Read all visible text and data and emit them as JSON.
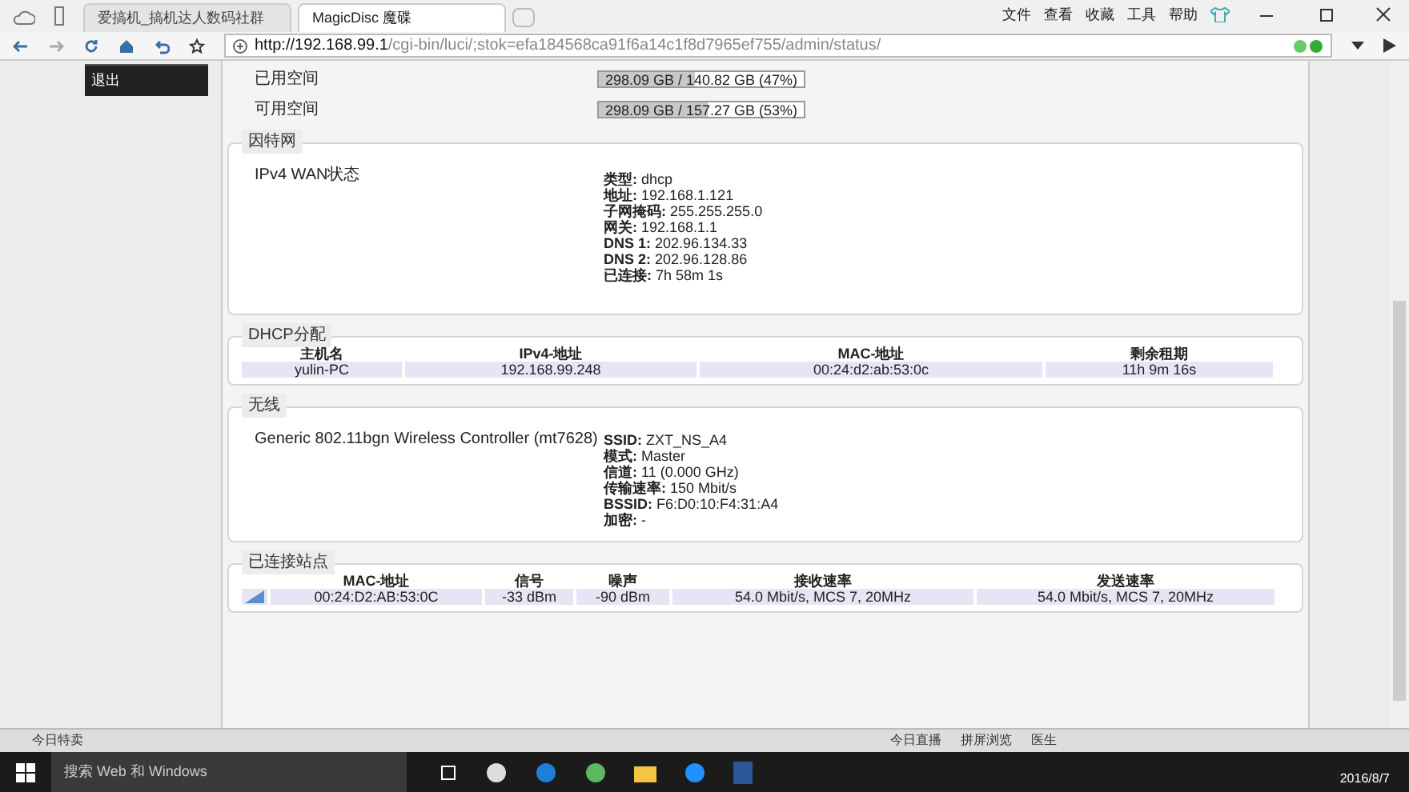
{
  "browser": {
    "tabs": [
      {
        "title": "爱搞机_搞机达人数码社群",
        "selected": false
      },
      {
        "title": "MagicDisc 魔碟",
        "selected": true
      }
    ],
    "menu": [
      "文件",
      "查看",
      "收藏",
      "工具",
      "帮助"
    ],
    "address": {
      "host": "http://192.168.99.1",
      "path": "/cgi-bin/luci/;stok=efa184568ca91f6a14c1f8d7965ef755/admin/status/"
    }
  },
  "side_menu": {
    "item": "退出"
  },
  "storage": [
    {
      "label": "已用空间",
      "reading": "298.09 GB / 140.82 GB (47%)",
      "level": 0.47
    },
    {
      "label": "可用空间",
      "reading": "298.09 GB / 157.27 GB (53%)",
      "level": 0.53
    }
  ],
  "internet": {
    "legend": "因特网",
    "name": "IPv4 WAN状态",
    "details": [
      {
        "key": "类型:",
        "value": "dhcp"
      },
      {
        "key": "地址:",
        "value": "192.168.1.121"
      },
      {
        "key": "子网掩码:",
        "value": "255.255.255.0"
      },
      {
        "key": "网关:",
        "value": "192.168.1.1"
      },
      {
        "key": "DNS 1:",
        "value": "202.96.134.33"
      },
      {
        "key": "DNS 2:",
        "value": "202.96.128.86"
      },
      {
        "key": "已连接:",
        "value": "7h 58m 1s"
      }
    ]
  },
  "dhcp": {
    "legend": "DHCP分配",
    "columns": [
      "主机名",
      "IPv4-地址",
      "MAC-地址",
      "剩余租期"
    ],
    "rows": [
      [
        "yulin-PC",
        "192.168.99.248",
        "00:24:d2:ab:53:0c",
        "11h 9m 16s"
      ]
    ]
  },
  "wireless": {
    "legend": "无线",
    "name": "Generic 802.11bgn Wireless Controller (mt7628)",
    "details": [
      {
        "key": "SSID:",
        "value": "ZXT_NS_A4"
      },
      {
        "key": "模式:",
        "value": "Master"
      },
      {
        "key": "信道:",
        "value": "11 (0.000 GHz)"
      },
      {
        "key": "传输速率:",
        "value": "150 Mbit/s"
      },
      {
        "key": "BSSID:",
        "value": "F6:D0:10:F4:31:A4"
      },
      {
        "key": "加密:",
        "value": "-"
      }
    ]
  },
  "stations": {
    "legend": "已连接站点",
    "columns": [
      "MAC-地址",
      "信号",
      "噪声",
      "接收速率",
      "发送速率"
    ],
    "rows": [
      [
        "00:24:D2:AB:53:0C",
        "-33 dBm",
        "-90 dBm",
        "54.0 Mbit/s, MCS 7, 20MHz",
        "54.0 Mbit/s, MCS 7, 20MHz"
      ]
    ]
  },
  "status_bar": {
    "left": "今日特卖",
    "right": [
      "今日直播",
      "拼屏浏览",
      "医生"
    ]
  },
  "taskbar": {
    "search": "搜索 Web 和 Windows",
    "date": "2016/8/7"
  }
}
